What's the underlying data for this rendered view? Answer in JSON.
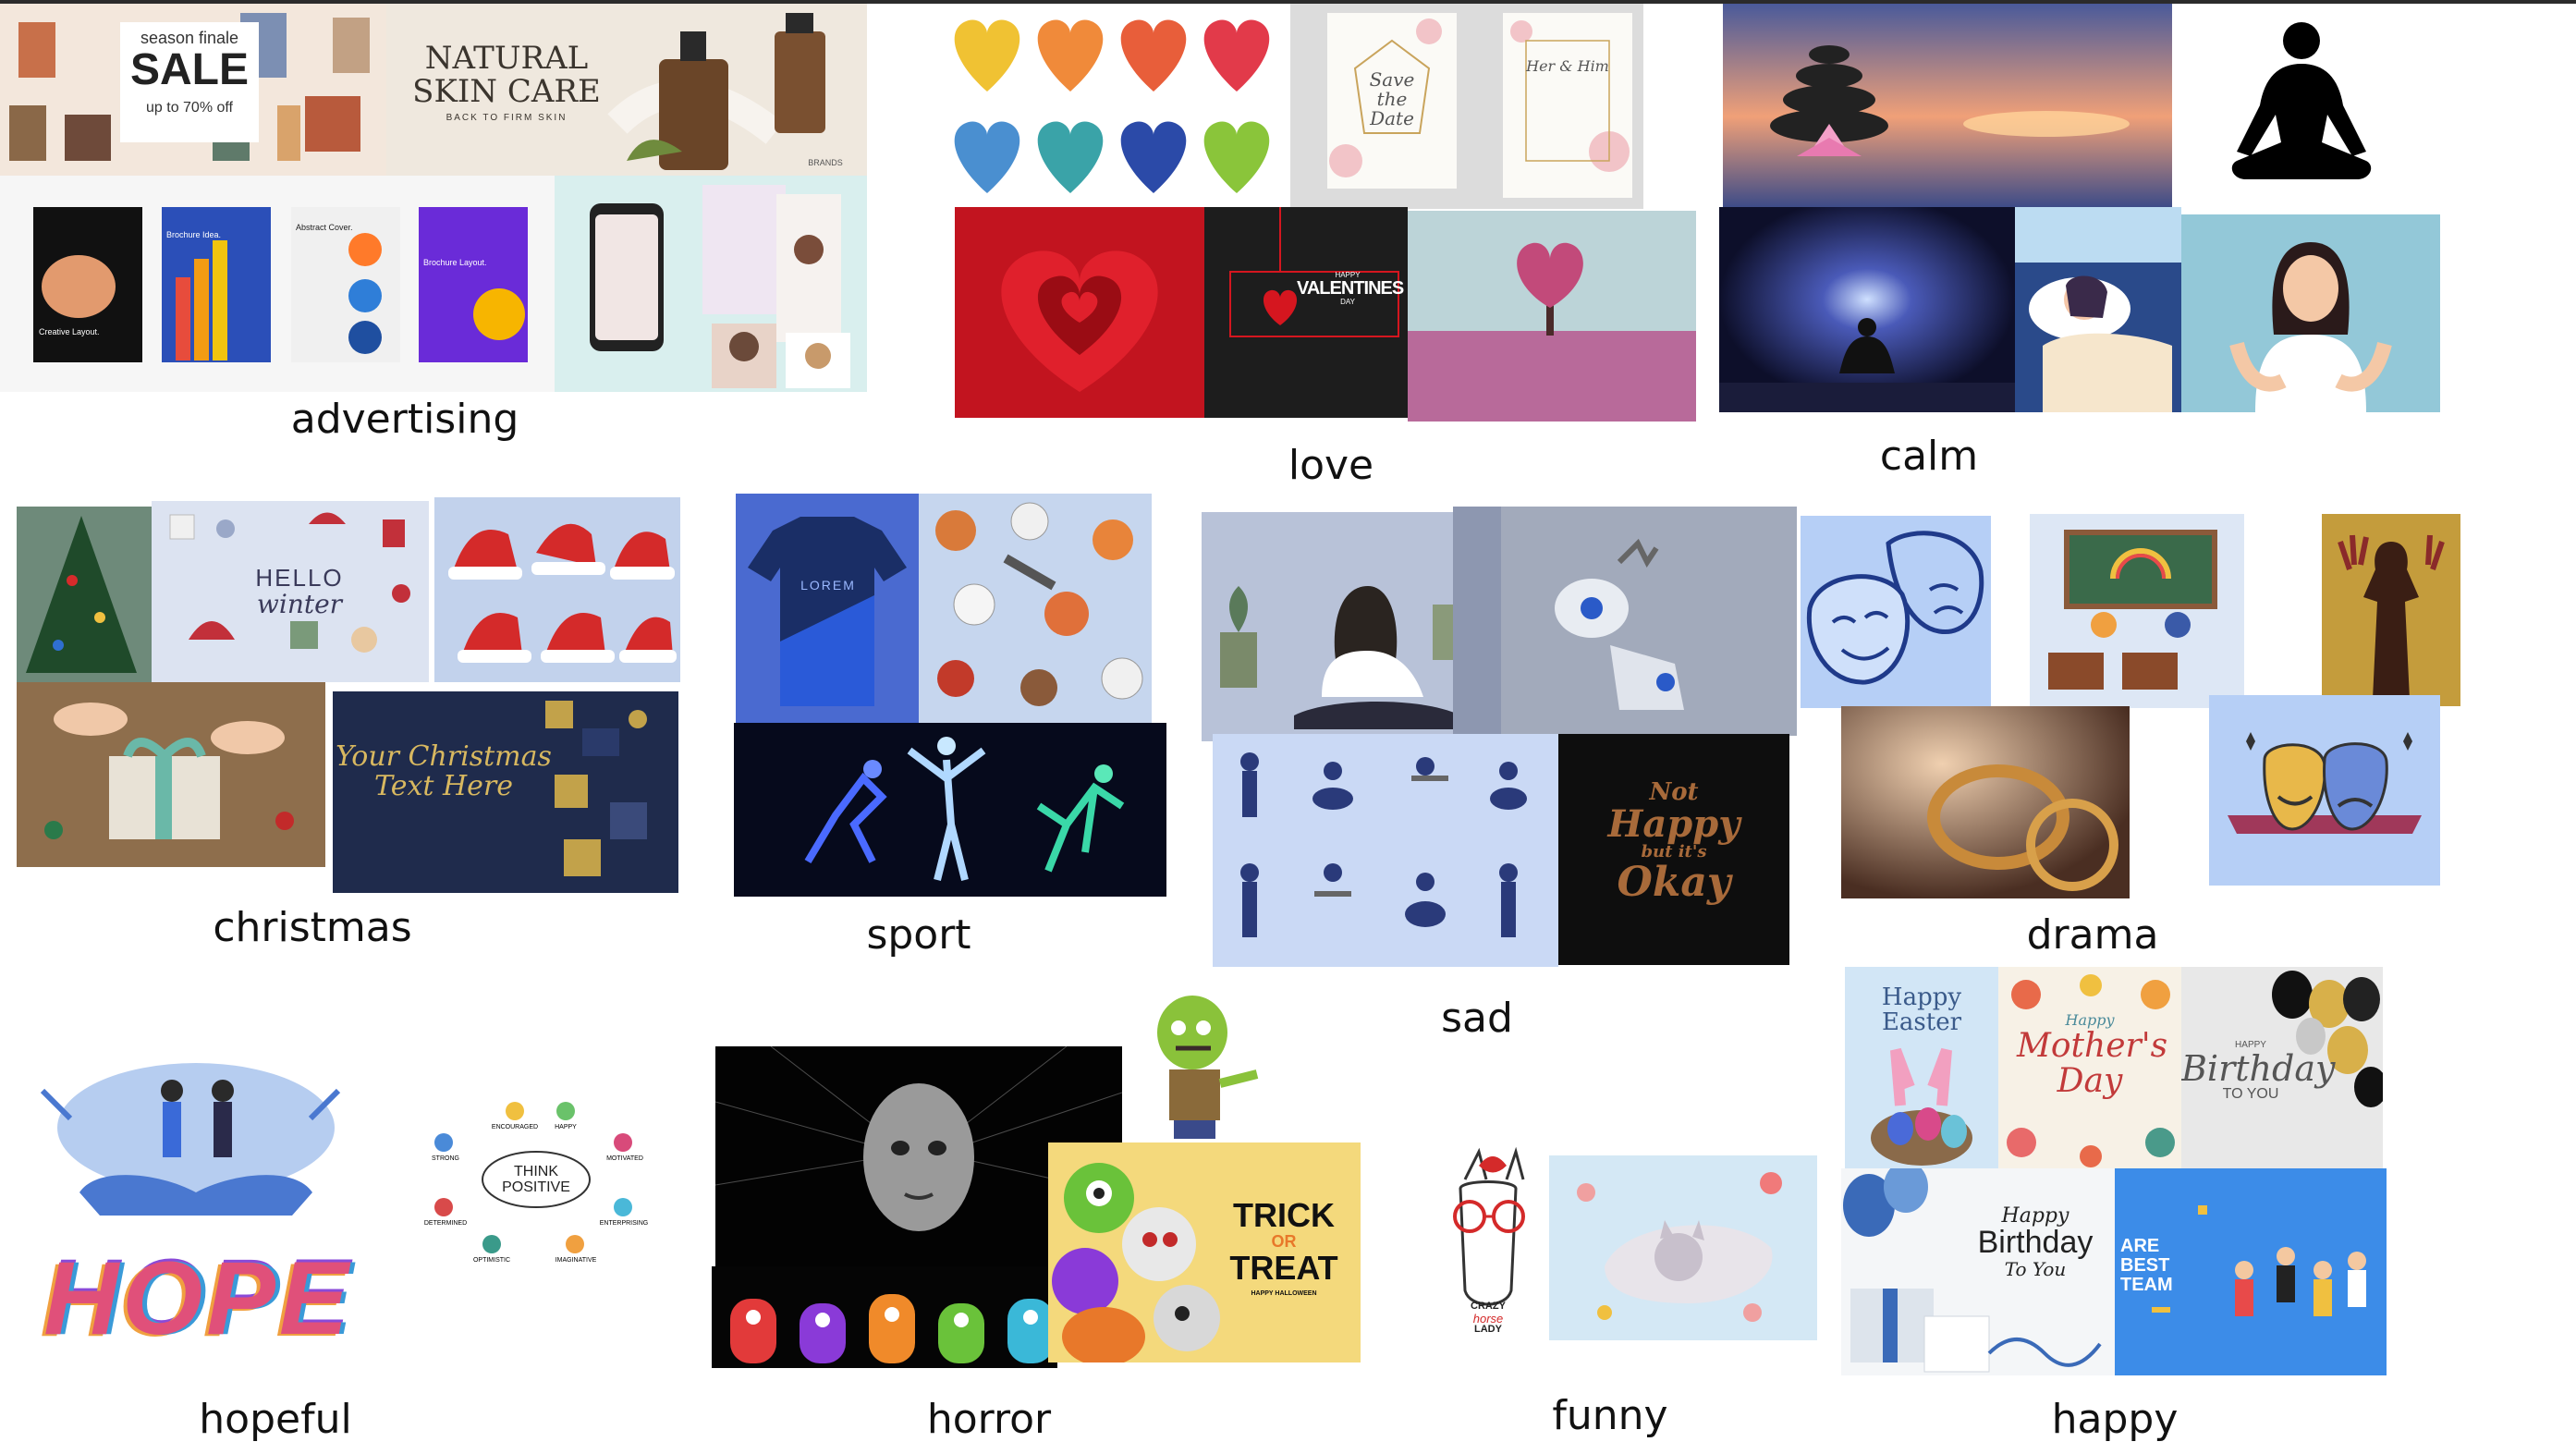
{
  "categories": {
    "advertising": "advertising",
    "love": "love",
    "calm": "calm",
    "christmas": "christmas",
    "sport": "sport",
    "sad": "sad",
    "drama": "drama",
    "hopeful": "hopeful",
    "horror": "horror",
    "funny": "funny",
    "happy": "happy"
  },
  "tiles": {
    "sale": {
      "line1": "season finale",
      "line2": "SALE",
      "line3": "up to 70% off"
    },
    "skincare": {
      "line1": "NATURAL",
      "line2": "SKIN CARE",
      "line3": "BACK TO FIRM SKIN",
      "brand": "BRANDS"
    },
    "brochure": {
      "b1": "Creative Layout.",
      "b2": "Brochure Idea.",
      "b3": "Abstract Cover.",
      "b4": "Brochure Layout."
    },
    "wedding": {
      "card1": "Save the Date",
      "card2": "Her & Him"
    },
    "valentines": {
      "line1": "HAPPY",
      "line2": "VALENTINES",
      "line3": "DAY"
    },
    "hello_winter": {
      "line1": "HELLO",
      "line2": "winter"
    },
    "christmas_text": {
      "line1": "Your Christmas",
      "line2": "Text Here"
    },
    "jersey": {
      "brand": "LOREM"
    },
    "okay": {
      "line1": "Not",
      "line2": "Happy",
      "line3": "but it's",
      "line4": "Okay"
    },
    "think_positive": {
      "center1": "THINK",
      "center2": "POSITIVE",
      "w1": "ENCOURAGED",
      "w2": "HAPPY",
      "w3": "STRONG",
      "w4": "MOTIVATED",
      "w5": "DETERMINED",
      "w6": "ENTERPRISING",
      "w7": "OPTIMISTIC",
      "w8": "IMAGINATIVE"
    },
    "hope": {
      "word": "HOPE"
    },
    "trick": {
      "line1": "TRICK",
      "line2": "OR",
      "line3": "TREAT",
      "line4": "HAPPY HALLOWEEN"
    },
    "crazy": {
      "line1": "CRAZY",
      "line2": "horse",
      "line3": "LADY"
    },
    "easter": {
      "line1": "Happy",
      "line2": "Easter"
    },
    "mothers": {
      "line1": "Happy",
      "line2": "Mother's",
      "line3": "Day"
    },
    "birthday1": {
      "line1": "HAPPY",
      "line2": "Birthday",
      "line3": "TO YOU"
    },
    "birthday2": {
      "line1": "Happy",
      "line2": "Birthday",
      "line3": "To You"
    },
    "team": {
      "line1": "ARE",
      "line2": "BEST TEAM"
    }
  },
  "colors": {
    "background": "#ffffff",
    "label": "#111111"
  }
}
